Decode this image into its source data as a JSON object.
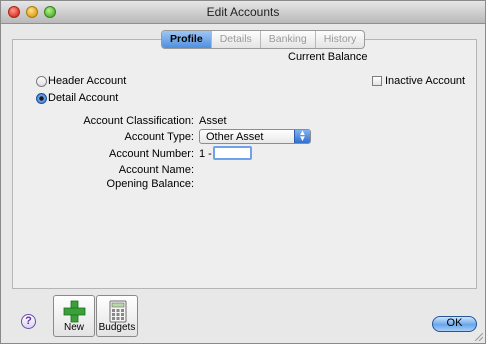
{
  "window": {
    "title": "Edit Accounts"
  },
  "tabs": [
    "Profile",
    "Details",
    "Banking",
    "History"
  ],
  "profile": {
    "current_balance_label": "Current Balance",
    "current_balance_sep": ":",
    "header_account_label": "Header Account",
    "detail_account_label": "Detail Account",
    "selected_type": "Detail Account",
    "inactive_label": "Inactive Account",
    "inactive_checked": false,
    "classification_label": "Account Classification:",
    "classification_value": "Asset",
    "account_type_label": "Account Type:",
    "account_type_value": "Other Asset",
    "account_number_label": "Account Number:",
    "account_number_prefix": "1 -",
    "account_number_value": "",
    "account_name_label": "Account Name:",
    "opening_balance_label": "Opening Balance:"
  },
  "toolbar": {
    "new_label": "New",
    "budgets_label": "Budgets",
    "help_glyph": "?",
    "ok_label": "OK"
  },
  "icons": {
    "new": "green-plus-icon",
    "budgets": "calculator-icon",
    "help": "help-icon"
  },
  "colors": {
    "accent": "#4f8fe0",
    "new_plus": "#3aa03a"
  }
}
